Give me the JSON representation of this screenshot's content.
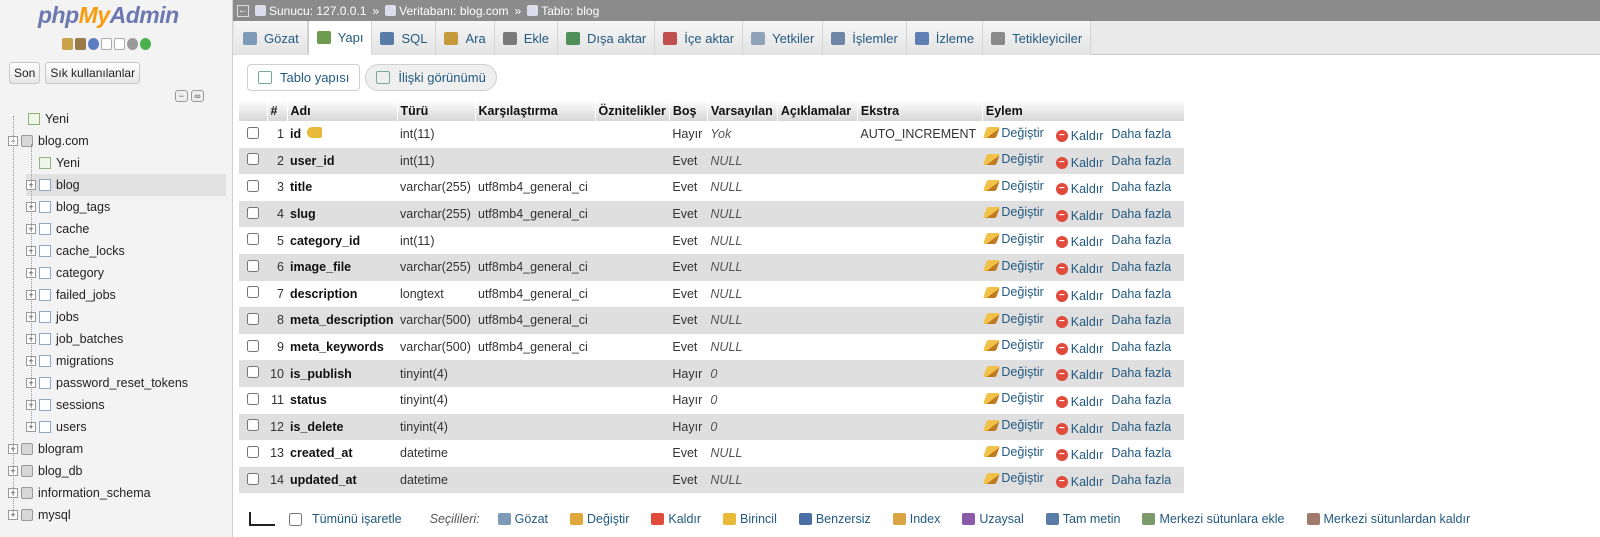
{
  "app": {
    "logo_php": "php",
    "logo_my": "My",
    "logo_admin": "Admin"
  },
  "sidebar": {
    "tabs": [
      "Son",
      "Sık kullanılanlar"
    ],
    "tree": [
      {
        "label": "Yeni",
        "type": "new"
      },
      {
        "label": "blog.com",
        "type": "db",
        "expanded": true
      },
      {
        "label": "Yeni",
        "type": "new"
      },
      {
        "label": "blog",
        "type": "table",
        "selected": true
      },
      {
        "label": "blog_tags",
        "type": "table"
      },
      {
        "label": "cache",
        "type": "table"
      },
      {
        "label": "cache_locks",
        "type": "table"
      },
      {
        "label": "category",
        "type": "table"
      },
      {
        "label": "failed_jobs",
        "type": "table"
      },
      {
        "label": "jobs",
        "type": "table"
      },
      {
        "label": "job_batches",
        "type": "table"
      },
      {
        "label": "migrations",
        "type": "table"
      },
      {
        "label": "password_reset_tokens",
        "type": "table"
      },
      {
        "label": "sessions",
        "type": "table"
      },
      {
        "label": "users",
        "type": "table"
      },
      {
        "label": "blogram",
        "type": "db"
      },
      {
        "label": "blog_db",
        "type": "db"
      },
      {
        "label": "information_schema",
        "type": "db"
      },
      {
        "label": "mysql",
        "type": "db"
      }
    ]
  },
  "breadcrumb": {
    "server": "Sunucu: 127.0.0.1",
    "database": "Veritabanı: blog.com",
    "table": "Tablo: blog",
    "separator": "»"
  },
  "nav": {
    "tabs": [
      {
        "label": "Gözat",
        "color": "#7d9bb8"
      },
      {
        "label": "Yapı",
        "color": "#6f9b4f",
        "active": true
      },
      {
        "label": "SQL",
        "color": "#5a7ca8"
      },
      {
        "label": "Ara",
        "color": "#c49a3a"
      },
      {
        "label": "Ekle",
        "color": "#7a7a7a"
      },
      {
        "label": "Dışa aktar",
        "color": "#4f8f5c"
      },
      {
        "label": "İçe aktar",
        "color": "#c0504d"
      },
      {
        "label": "Yetkiler",
        "color": "#8fa3b8"
      },
      {
        "label": "İşlemler",
        "color": "#6f86a6"
      },
      {
        "label": "İzleme",
        "color": "#5f7fb3"
      },
      {
        "label": "Tetikleyiciler",
        "color": "#8a8a8a"
      }
    ]
  },
  "subtabs": [
    "Tablo yapısı",
    "İlişki görünümü"
  ],
  "table": {
    "headers": [
      "#",
      "Adı",
      "Türü",
      "Karşılaştırma",
      "Öznitelikler",
      "Boş",
      "Varsayılan",
      "Açıklamalar",
      "Ekstra",
      "Eylem"
    ],
    "action_labels": {
      "edit": "Değiştir",
      "drop": "Kaldır",
      "more": "Daha fazla"
    },
    "rows": [
      {
        "n": "1",
        "name": "id",
        "type": "int(11)",
        "coll": "",
        "attr": "",
        "null": "Hayır",
        "def": "Yok",
        "com": "",
        "extra": "AUTO_INCREMENT",
        "key": true
      },
      {
        "n": "2",
        "name": "user_id",
        "type": "int(11)",
        "coll": "",
        "attr": "",
        "null": "Evet",
        "def": "NULL",
        "com": "",
        "extra": ""
      },
      {
        "n": "3",
        "name": "title",
        "type": "varchar(255)",
        "coll": "utf8mb4_general_ci",
        "attr": "",
        "null": "Evet",
        "def": "NULL",
        "com": "",
        "extra": ""
      },
      {
        "n": "4",
        "name": "slug",
        "type": "varchar(255)",
        "coll": "utf8mb4_general_ci",
        "attr": "",
        "null": "Evet",
        "def": "NULL",
        "com": "",
        "extra": ""
      },
      {
        "n": "5",
        "name": "category_id",
        "type": "int(11)",
        "coll": "",
        "attr": "",
        "null": "Evet",
        "def": "NULL",
        "com": "",
        "extra": ""
      },
      {
        "n": "6",
        "name": "image_file",
        "type": "varchar(255)",
        "coll": "utf8mb4_general_ci",
        "attr": "",
        "null": "Evet",
        "def": "NULL",
        "com": "",
        "extra": ""
      },
      {
        "n": "7",
        "name": "description",
        "type": "longtext",
        "coll": "utf8mb4_general_ci",
        "attr": "",
        "null": "Evet",
        "def": "NULL",
        "com": "",
        "extra": ""
      },
      {
        "n": "8",
        "name": "meta_description",
        "type": "varchar(500)",
        "coll": "utf8mb4_general_ci",
        "attr": "",
        "null": "Evet",
        "def": "NULL",
        "com": "",
        "extra": ""
      },
      {
        "n": "9",
        "name": "meta_keywords",
        "type": "varchar(500)",
        "coll": "utf8mb4_general_ci",
        "attr": "",
        "null": "Evet",
        "def": "NULL",
        "com": "",
        "extra": ""
      },
      {
        "n": "10",
        "name": "is_publish",
        "type": "tinyint(4)",
        "coll": "",
        "attr": "",
        "null": "Hayır",
        "def": "0",
        "com": "",
        "extra": ""
      },
      {
        "n": "11",
        "name": "status",
        "type": "tinyint(4)",
        "coll": "",
        "attr": "",
        "null": "Hayır",
        "def": "0",
        "com": "",
        "extra": ""
      },
      {
        "n": "12",
        "name": "is_delete",
        "type": "tinyint(4)",
        "coll": "",
        "attr": "",
        "null": "Hayır",
        "def": "0",
        "com": "",
        "extra": ""
      },
      {
        "n": "13",
        "name": "created_at",
        "type": "datetime",
        "coll": "",
        "attr": "",
        "null": "Evet",
        "def": "NULL",
        "com": "",
        "extra": ""
      },
      {
        "n": "14",
        "name": "updated_at",
        "type": "datetime",
        "coll": "",
        "attr": "",
        "null": "Evet",
        "def": "NULL",
        "com": "",
        "extra": ""
      }
    ]
  },
  "bottom": {
    "check_all": "Tümünü işaretle",
    "with_selected": "Seçilileri:",
    "actions": [
      {
        "label": "Gözat",
        "color": "#7d9bb8"
      },
      {
        "label": "Değiştir",
        "color": "#e0a83a"
      },
      {
        "label": "Kaldır",
        "color": "#e04b3c"
      },
      {
        "label": "Birincil",
        "color": "#e9b93a"
      },
      {
        "label": "Benzersiz",
        "color": "#4a6fa5"
      },
      {
        "label": "Index",
        "color": "#d9a441"
      },
      {
        "label": "Uzaysal",
        "color": "#8a5aa8"
      },
      {
        "label": "Tam metin",
        "color": "#5a7ca8"
      },
      {
        "label": "Merkezi sütunlara ekle",
        "color": "#7a9a6a"
      },
      {
        "label": "Merkezi sütunlardan kaldır",
        "color": "#a07a6a"
      }
    ]
  }
}
